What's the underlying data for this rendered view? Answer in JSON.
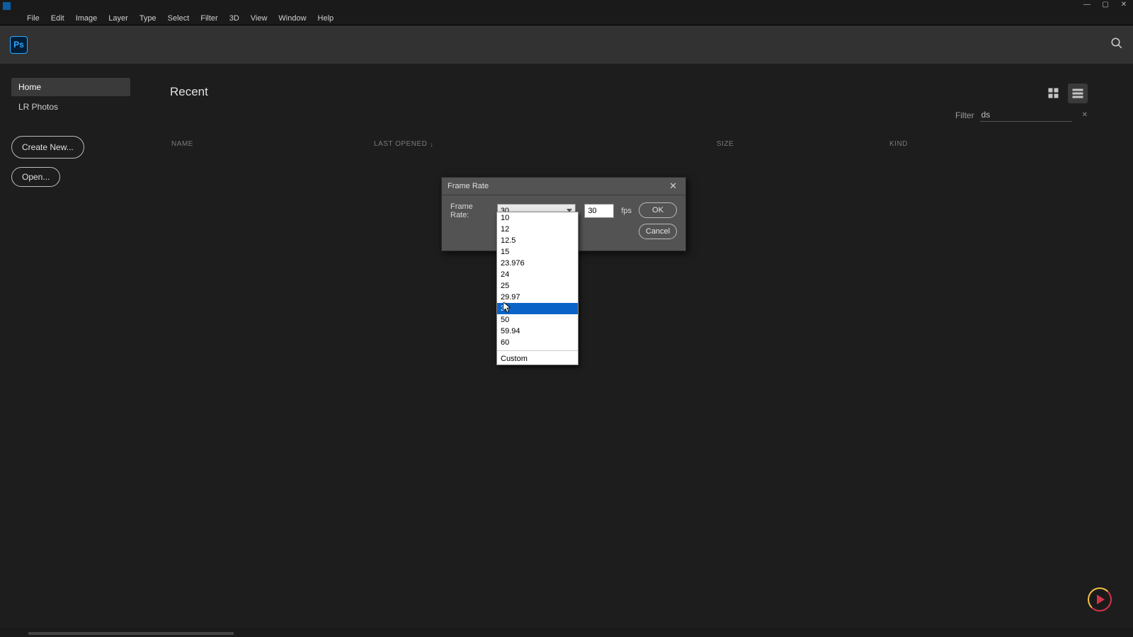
{
  "menu": {
    "items": [
      "File",
      "Edit",
      "Image",
      "Layer",
      "Type",
      "Select",
      "Filter",
      "3D",
      "View",
      "Window",
      "Help"
    ]
  },
  "logo_text": "Ps",
  "sidebar": {
    "home": "Home",
    "lr": "LR Photos",
    "create": "Create New...",
    "open": "Open..."
  },
  "content": {
    "recent": "Recent",
    "filter_label": "Filter",
    "filter_value": "ds",
    "headers": {
      "name": "NAME",
      "last_opened": "LAST OPENED",
      "size": "SIZE",
      "kind": "KIND"
    }
  },
  "dialog": {
    "title": "Frame Rate",
    "label": "Frame Rate:",
    "combo_value": "30",
    "input_value": "30",
    "fps": "fps",
    "ok": "OK",
    "cancel": "Cancel"
  },
  "dropdown": {
    "items": [
      "10",
      "12",
      "12.5",
      "15",
      "23.976",
      "24",
      "25",
      "29.97",
      "30",
      "50",
      "59.94",
      "60"
    ],
    "selected_index": 8,
    "custom": "Custom"
  }
}
